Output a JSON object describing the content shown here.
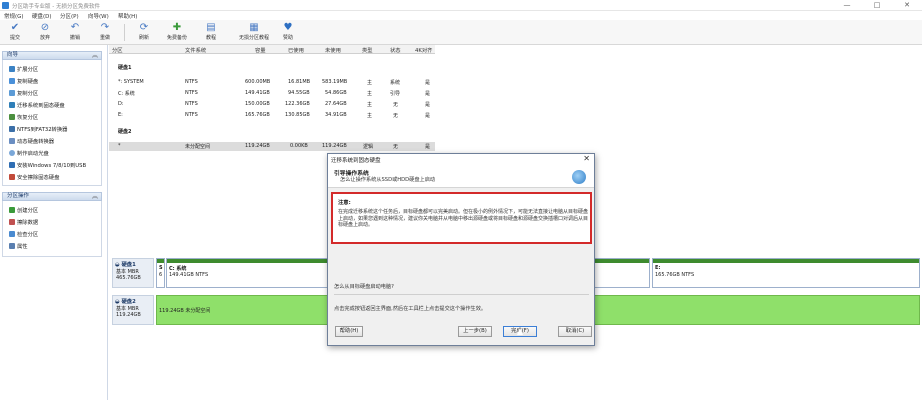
{
  "window": {
    "title": "分区助手专业版 - 无损分区免费软件",
    "minimize": "—",
    "maximize": "□",
    "close": "✕"
  },
  "menu": [
    "常规(G)",
    "硬盘(D)",
    "分区(P)",
    "向导(W)",
    "帮助(H)"
  ],
  "toolbar": [
    {
      "label": "提交",
      "icon": "commit-icon"
    },
    {
      "label": "放弃",
      "icon": "discard-icon"
    },
    {
      "label": "撤销",
      "icon": "undo-icon"
    },
    {
      "label": "重做",
      "icon": "redo-icon"
    },
    {
      "label": "刷新",
      "icon": "refresh-icon"
    },
    {
      "label": "免费备份",
      "icon": "backup-icon"
    },
    {
      "label": "教程",
      "icon": "tutorial-icon"
    },
    {
      "label": "无损分区教程",
      "icon": "partition-tutorial-icon"
    },
    {
      "label": "赞助",
      "icon": "sponsor-icon"
    }
  ],
  "sidebar": {
    "wizard_title": "向导",
    "wizard_items": [
      "扩展分区",
      "复制硬盘",
      "复制分区",
      "迁移系统到固态硬盘",
      "恢复分区",
      "NTFS到FAT32转换器",
      "动态硬盘转换器",
      "制作启动光盘",
      "安装Windows 7/8/10到USB",
      "安全擦除固态硬盘"
    ],
    "ops_title": "分区操作",
    "ops_items": [
      "创建分区",
      "擦除数据",
      "检查分区",
      "属性"
    ]
  },
  "table": {
    "columns": [
      "分区",
      "文件系统",
      "容量",
      "已使用",
      "未使用",
      "类型",
      "状态",
      "4K对齐"
    ],
    "disk1_label": "硬盘1",
    "disk1_rows": [
      [
        "*: SYSTEM",
        "NTFS",
        "600.00MB",
        "16.81MB",
        "583.19MB",
        "主",
        "系统",
        "是"
      ],
      [
        "C: 系统",
        "NTFS",
        "149.41GB",
        "94.55GB",
        "54.86GB",
        "主",
        "引导",
        "是"
      ],
      [
        "D:",
        "NTFS",
        "150.00GB",
        "122.36GB",
        "27.64GB",
        "主",
        "无",
        "是"
      ],
      [
        "E:",
        "NTFS",
        "165.76GB",
        "130.85GB",
        "34.91GB",
        "主",
        "无",
        "是"
      ]
    ],
    "disk2_label": "硬盘2",
    "disk2_rows": [
      [
        "*",
        "未分配空间",
        "119.24GB",
        "0.00KB",
        "119.24GB",
        "逻辑",
        "无",
        "是"
      ]
    ]
  },
  "diskmap": {
    "disk1": {
      "name": "硬盘1",
      "type": "基本 MBR",
      "size": "465.76GB",
      "parts": [
        {
          "l1": "S",
          "l2": "6"
        },
        {
          "l1": "C: 系统",
          "l2": "149.41GB NTFS"
        },
        {
          "l1": "E:",
          "l2": "165.76GB NTFS"
        }
      ]
    },
    "disk2": {
      "name": "硬盘2",
      "type": "基本 MBR",
      "size": "119.24GB",
      "parts": [
        {
          "l1": "119.24GB 未分配空间",
          "l2": ""
        }
      ]
    }
  },
  "dialog": {
    "title": "迁移系统到固态硬盘",
    "heading": "引导操作系统",
    "subheading": "怎么让操作系统从SSD或HDD硬盘上启动",
    "notice_title": "注意:",
    "notice_body": "在完成迁移系统这个任务后，目标硬盘都可以完美启动。但在极小的例外情况下，可能无法直接让电脑从目标硬盘上启动，如果您遇到这种情况，建议你关电脑并从电脑中移出源硬盘或将目标硬盘和源硬盘交换插槽口对调后从目标硬盘上启动。",
    "question": "怎么从目标硬盘启动电脑?",
    "footer_note": "点击完成按钮返回主界面,然后在工具栏上点击提交这个操作生效。",
    "buttons": {
      "help": "帮助(H)",
      "back": "上一步(B)",
      "finish": "完成(F)",
      "cancel": "取消(C)"
    }
  }
}
